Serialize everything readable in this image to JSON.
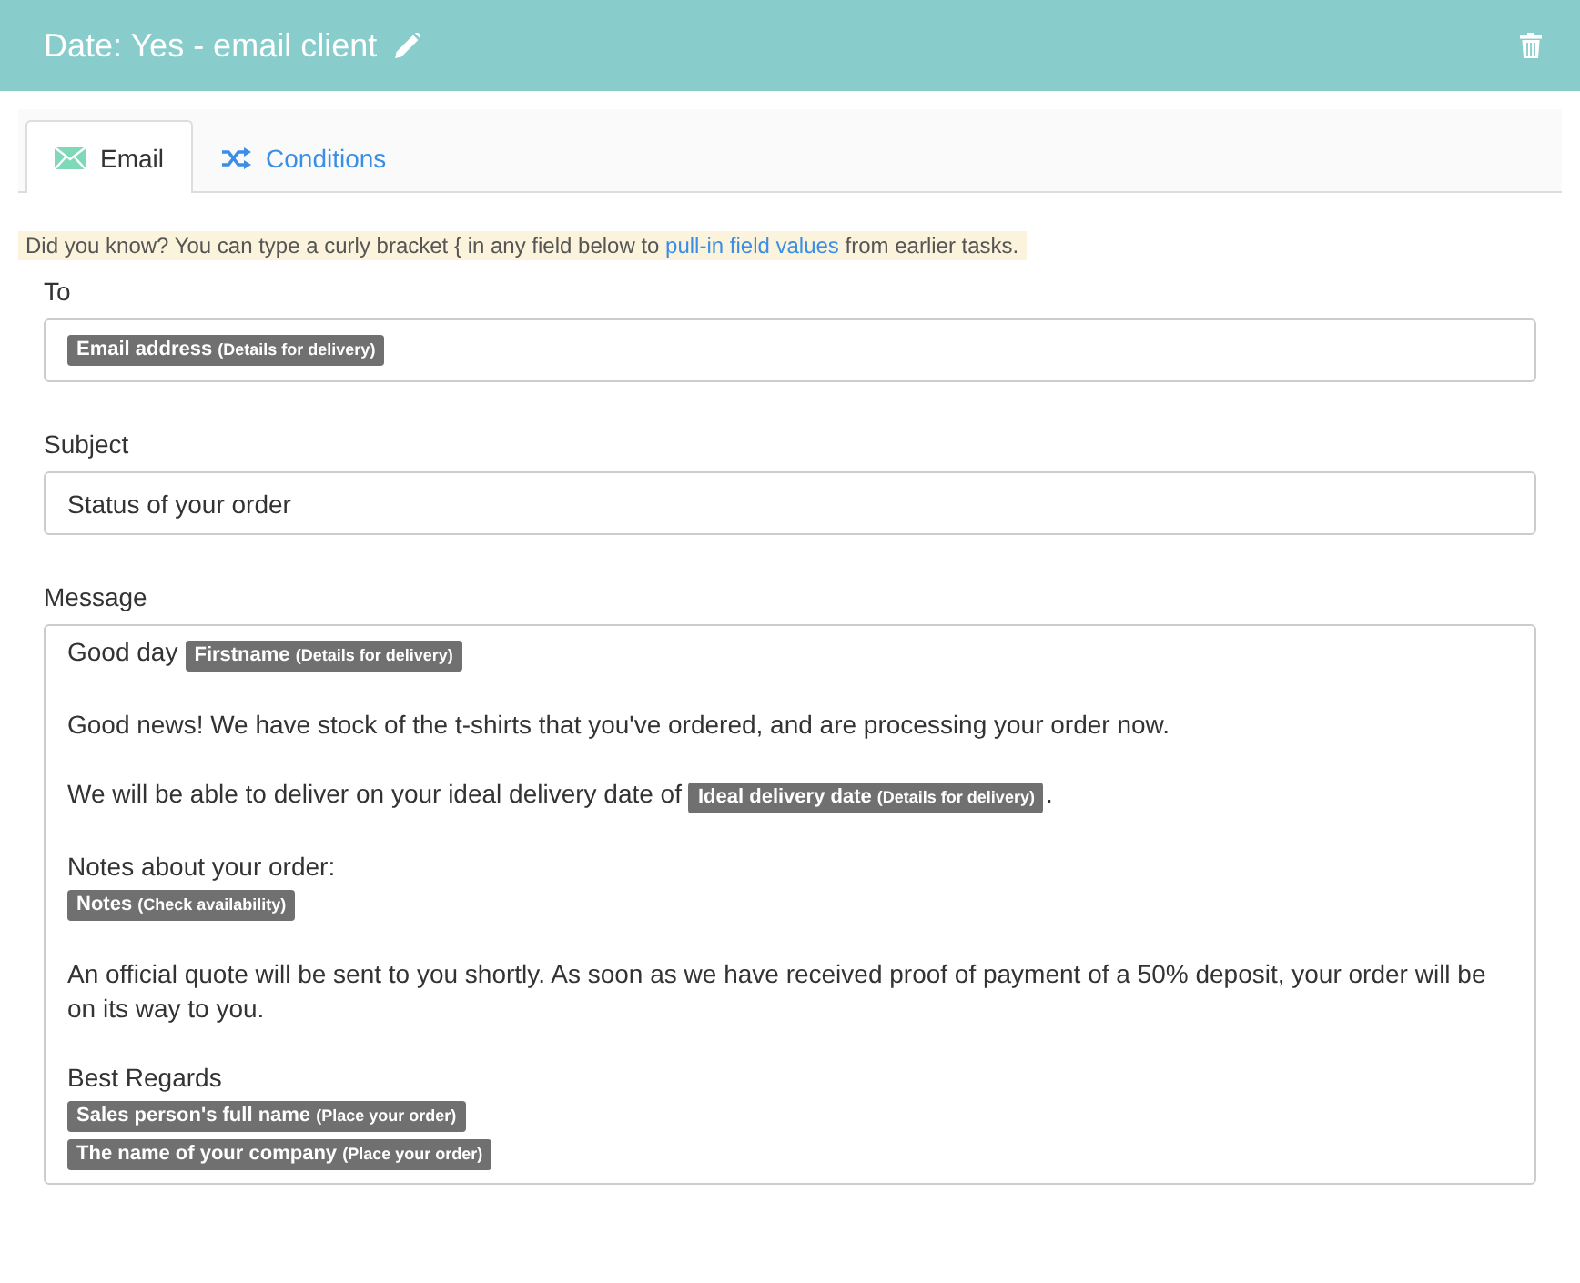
{
  "header": {
    "title": "Date: Yes - email client"
  },
  "tabs": [
    {
      "label": "Email",
      "kind": "envelope",
      "selected": true
    },
    {
      "label": "Conditions",
      "kind": "shuffle",
      "selected": false
    }
  ],
  "tip": {
    "before": "Did you know? You can type a curly bracket { in any field below to",
    "link": "pull-in field values",
    "after": "from earlier tasks."
  },
  "to": {
    "label": "To",
    "tokens": [
      {
        "field": "Email address",
        "source": "(Details for delivery)"
      }
    ]
  },
  "subject": {
    "label": "Subject",
    "value": "Status of your order"
  },
  "message": {
    "label": "Message",
    "paragraphs": [
      [
        [
          {
            "kind": "text",
            "text": "Good day"
          },
          {
            "kind": "token",
            "field": "Firstname",
            "source": "(Details for delivery)"
          }
        ]
      ],
      [
        [
          {
            "kind": "text",
            "text": "Good news! We have stock of the t-shirts that you've ordered, and are processing your order now."
          }
        ]
      ],
      [
        [
          {
            "kind": "text",
            "text": "We will be able to deliver on your ideal delivery date of"
          },
          {
            "kind": "token",
            "field": "Ideal delivery date",
            "source": "(Details for delivery)"
          },
          {
            "kind": "text",
            "text": "."
          }
        ]
      ],
      [
        [
          {
            "kind": "text",
            "text": "Notes about your order:"
          }
        ],
        [
          {
            "kind": "token",
            "field": "Notes",
            "source": "(Check availability)"
          }
        ]
      ],
      [
        [
          {
            "kind": "text",
            "text": "An official quote will be sent to you shortly. As soon as we have received proof of payment of a 50% deposit, your order will be on its way to you."
          }
        ]
      ],
      [
        [
          {
            "kind": "text",
            "text": "Best Regards"
          }
        ],
        [
          {
            "kind": "token",
            "field": "Sales person's full name",
            "source": "(Place your order)"
          }
        ],
        [
          {
            "kind": "token",
            "field": "The name of your company",
            "source": "(Place your order)"
          }
        ]
      ]
    ]
  }
}
